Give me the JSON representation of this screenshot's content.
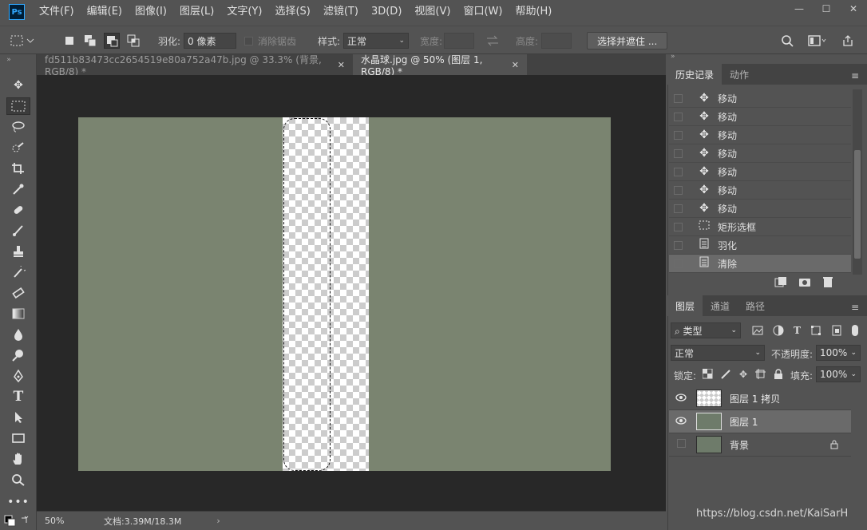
{
  "menubar": {
    "logo": "Ps",
    "items": [
      "文件(F)",
      "编辑(E)",
      "图像(I)",
      "图层(L)",
      "文字(Y)",
      "选择(S)",
      "滤镜(T)",
      "3D(D)",
      "视图(V)",
      "窗口(W)",
      "帮助(H)"
    ]
  },
  "window_controls": {
    "minimize": "—",
    "maximize": "☐",
    "close": "✕"
  },
  "options": {
    "feather_label": "羽化:",
    "feather_value": "0 像素",
    "antialias_label": "消除锯齿",
    "style_label": "样式:",
    "style_value": "正常",
    "width_label": "宽度:",
    "height_label": "高度:",
    "select_mask_button": "选择并遮住 ..."
  },
  "tabs": [
    {
      "label": "fd511b83473cc2654519e80a752a47b.jpg @ 33.3% (背景, RGB/8) *",
      "active": false
    },
    {
      "label": "水晶球.jpg @ 50% (图层 1, RGB/8) *",
      "active": true
    }
  ],
  "status": {
    "zoom": "50%",
    "doc": "文档:3.39M/18.3M"
  },
  "history_panel": {
    "tabs": [
      "历史记录",
      "动作"
    ],
    "items": [
      {
        "icon": "move",
        "label": "移动"
      },
      {
        "icon": "move",
        "label": "移动"
      },
      {
        "icon": "move",
        "label": "移动"
      },
      {
        "icon": "move",
        "label": "移动"
      },
      {
        "icon": "move",
        "label": "移动"
      },
      {
        "icon": "move",
        "label": "移动"
      },
      {
        "icon": "move",
        "label": "移动"
      },
      {
        "icon": "marquee",
        "label": "矩形选框"
      },
      {
        "icon": "doc",
        "label": "羽化"
      },
      {
        "icon": "doc",
        "label": "清除"
      }
    ],
    "selected_index": 9
  },
  "layers_panel": {
    "tabs": [
      "图层",
      "通道",
      "路径"
    ],
    "filter_kind": "类型",
    "blend_mode": "正常",
    "opacity_label": "不透明度:",
    "opacity_value": "100%",
    "lock_label": "锁定:",
    "fill_label": "填充:",
    "fill_value": "100%",
    "layers": [
      {
        "name": "图层 1 拷贝",
        "visible": true,
        "selected": false,
        "locked": false
      },
      {
        "name": "图层 1",
        "visible": true,
        "selected": true,
        "locked": false
      },
      {
        "name": "背景",
        "visible": false,
        "selected": false,
        "locked": true
      }
    ]
  },
  "watermark": "https://blog.csdn.net/KaiSarH"
}
